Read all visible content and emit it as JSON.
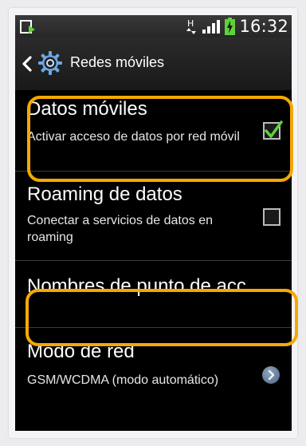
{
  "status_bar": {
    "time": "16:32",
    "network_type": "H",
    "icons": [
      "download-notification-icon",
      "signal-strength-icon",
      "battery-charging-icon"
    ]
  },
  "action_bar": {
    "title": "Redes móviles",
    "icons": [
      "back-chevron-icon",
      "settings-gear-icon"
    ]
  },
  "settings": [
    {
      "title": "Datos móviles",
      "summary": "Activar acceso de datos por red móvil",
      "control": "checkbox",
      "checked": true
    },
    {
      "title": "Roaming de datos",
      "summary": "Conectar a servicios de datos en roaming",
      "control": "checkbox",
      "checked": false
    },
    {
      "title": "Nombres de punto de acc...",
      "summary": "",
      "control": "none"
    },
    {
      "title": "Modo de red",
      "summary": "GSM/WCDMA (modo automático)",
      "control": "chevron"
    }
  ],
  "colors": {
    "highlight": "#f5a800",
    "check_green": "#5fd23a",
    "background": "#000000",
    "text": "#ffffff"
  }
}
